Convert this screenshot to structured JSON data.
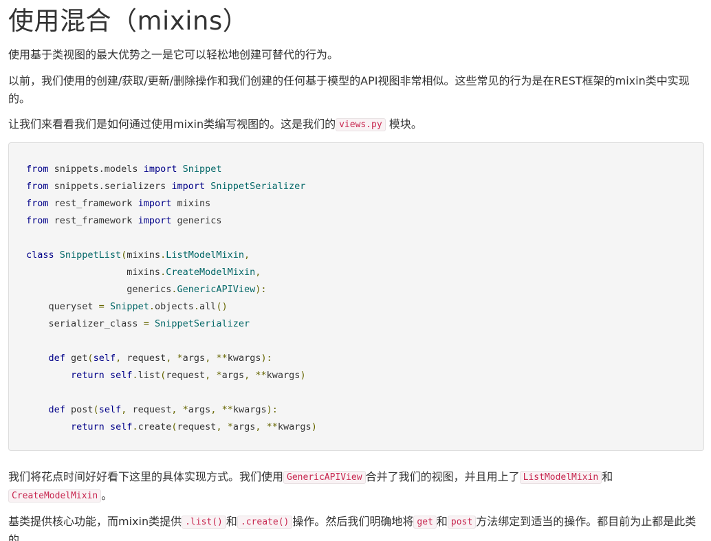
{
  "heading": "使用混合（mixins）",
  "para1": "使用基于类视图的最大优势之一是它可以轻松地创建可替代的行为。",
  "para2": "以前，我们使用的创建/获取/更新/删除操作和我们创建的任何基于模型的API视图非常相似。这些常见的行为是在REST框架的mixin类中实现的。",
  "para3": {
    "before": "让我们来看看我们是如何通过使用mixin类编写视图的。这是我们的",
    "code": "views.py",
    "after": "模块。"
  },
  "code_lines": [
    [
      {
        "t": "from",
        "c": "kw"
      },
      {
        "t": " snippets.models ",
        "c": "pl"
      },
      {
        "t": "import",
        "c": "kw"
      },
      {
        "t": " ",
        "c": "pl"
      },
      {
        "t": "Snippet",
        "c": "tp"
      }
    ],
    [
      {
        "t": "from",
        "c": "kw"
      },
      {
        "t": " snippets.serializers ",
        "c": "pl"
      },
      {
        "t": "import",
        "c": "kw"
      },
      {
        "t": " ",
        "c": "pl"
      },
      {
        "t": "SnippetSerializer",
        "c": "tp"
      }
    ],
    [
      {
        "t": "from",
        "c": "kw"
      },
      {
        "t": " rest_framework ",
        "c": "pl"
      },
      {
        "t": "import",
        "c": "kw"
      },
      {
        "t": " mixins",
        "c": "pl"
      }
    ],
    [
      {
        "t": "from",
        "c": "kw"
      },
      {
        "t": " rest_framework ",
        "c": "pl"
      },
      {
        "t": "import",
        "c": "kw"
      },
      {
        "t": " generics",
        "c": "pl"
      }
    ],
    [],
    [
      {
        "t": "class",
        "c": "kw"
      },
      {
        "t": " ",
        "c": "pl"
      },
      {
        "t": "SnippetList",
        "c": "tp"
      },
      {
        "t": "(",
        "c": "pn"
      },
      {
        "t": "mixins",
        "c": "pl"
      },
      {
        "t": ".",
        "c": "pn"
      },
      {
        "t": "ListModelMixin",
        "c": "tp"
      },
      {
        "t": ",",
        "c": "pn"
      }
    ],
    [
      {
        "t": "                  mixins",
        "c": "pl"
      },
      {
        "t": ".",
        "c": "pn"
      },
      {
        "t": "CreateModelMixin",
        "c": "tp"
      },
      {
        "t": ",",
        "c": "pn"
      }
    ],
    [
      {
        "t": "                  generics",
        "c": "pl"
      },
      {
        "t": ".",
        "c": "pn"
      },
      {
        "t": "GenericAPIView",
        "c": "tp"
      },
      {
        "t": "):",
        "c": "pn"
      }
    ],
    [
      {
        "t": "    queryset ",
        "c": "pl"
      },
      {
        "t": "=",
        "c": "pn"
      },
      {
        "t": " ",
        "c": "pl"
      },
      {
        "t": "Snippet",
        "c": "tp"
      },
      {
        "t": ".",
        "c": "pn"
      },
      {
        "t": "objects",
        "c": "pl"
      },
      {
        "t": ".",
        "c": "pn"
      },
      {
        "t": "all",
        "c": "pl"
      },
      {
        "t": "()",
        "c": "pn"
      }
    ],
    [
      {
        "t": "    serializer_class ",
        "c": "pl"
      },
      {
        "t": "=",
        "c": "pn"
      },
      {
        "t": " ",
        "c": "pl"
      },
      {
        "t": "SnippetSerializer",
        "c": "tp"
      }
    ],
    [],
    [
      {
        "t": "    ",
        "c": "pl"
      },
      {
        "t": "def",
        "c": "kw"
      },
      {
        "t": " get",
        "c": "pl"
      },
      {
        "t": "(",
        "c": "pn"
      },
      {
        "t": "self",
        "c": "kw"
      },
      {
        "t": ",",
        "c": "pn"
      },
      {
        "t": " request",
        "c": "pl"
      },
      {
        "t": ",",
        "c": "pn"
      },
      {
        "t": " ",
        "c": "pl"
      },
      {
        "t": "*",
        "c": "pn"
      },
      {
        "t": "args",
        "c": "pl"
      },
      {
        "t": ",",
        "c": "pn"
      },
      {
        "t": " ",
        "c": "pl"
      },
      {
        "t": "**",
        "c": "pn"
      },
      {
        "t": "kwargs",
        "c": "pl"
      },
      {
        "t": "):",
        "c": "pn"
      }
    ],
    [
      {
        "t": "        ",
        "c": "pl"
      },
      {
        "t": "return",
        "c": "kw"
      },
      {
        "t": " ",
        "c": "pl"
      },
      {
        "t": "self",
        "c": "kw"
      },
      {
        "t": ".",
        "c": "pn"
      },
      {
        "t": "list",
        "c": "pl"
      },
      {
        "t": "(",
        "c": "pn"
      },
      {
        "t": "request",
        "c": "pl"
      },
      {
        "t": ",",
        "c": "pn"
      },
      {
        "t": " ",
        "c": "pl"
      },
      {
        "t": "*",
        "c": "pn"
      },
      {
        "t": "args",
        "c": "pl"
      },
      {
        "t": ",",
        "c": "pn"
      },
      {
        "t": " ",
        "c": "pl"
      },
      {
        "t": "**",
        "c": "pn"
      },
      {
        "t": "kwargs",
        "c": "pl"
      },
      {
        "t": ")",
        "c": "pn"
      }
    ],
    [],
    [
      {
        "t": "    ",
        "c": "pl"
      },
      {
        "t": "def",
        "c": "kw"
      },
      {
        "t": " post",
        "c": "pl"
      },
      {
        "t": "(",
        "c": "pn"
      },
      {
        "t": "self",
        "c": "kw"
      },
      {
        "t": ",",
        "c": "pn"
      },
      {
        "t": " request",
        "c": "pl"
      },
      {
        "t": ",",
        "c": "pn"
      },
      {
        "t": " ",
        "c": "pl"
      },
      {
        "t": "*",
        "c": "pn"
      },
      {
        "t": "args",
        "c": "pl"
      },
      {
        "t": ",",
        "c": "pn"
      },
      {
        "t": " ",
        "c": "pl"
      },
      {
        "t": "**",
        "c": "pn"
      },
      {
        "t": "kwargs",
        "c": "pl"
      },
      {
        "t": "):",
        "c": "pn"
      }
    ],
    [
      {
        "t": "        ",
        "c": "pl"
      },
      {
        "t": "return",
        "c": "kw"
      },
      {
        "t": " ",
        "c": "pl"
      },
      {
        "t": "self",
        "c": "kw"
      },
      {
        "t": ".",
        "c": "pn"
      },
      {
        "t": "create",
        "c": "pl"
      },
      {
        "t": "(",
        "c": "pn"
      },
      {
        "t": "request",
        "c": "pl"
      },
      {
        "t": ",",
        "c": "pn"
      },
      {
        "t": " ",
        "c": "pl"
      },
      {
        "t": "*",
        "c": "pn"
      },
      {
        "t": "args",
        "c": "pl"
      },
      {
        "t": ",",
        "c": "pn"
      },
      {
        "t": " ",
        "c": "pl"
      },
      {
        "t": "**",
        "c": "pn"
      },
      {
        "t": "kwargs",
        "c": "pl"
      },
      {
        "t": ")",
        "c": "pn"
      }
    ]
  ],
  "para4": {
    "t1": "我们将花点时间好好看下这里的具体实现方式。我们使用",
    "c1": "GenericAPIView",
    "t2": "合并了我们的视图，并且用上了",
    "c2": "ListModelMixin",
    "t3": "和",
    "c3": "CreateModelMixin",
    "t4": "。"
  },
  "para5": {
    "t1": "基类提供核心功能，而mixin类提供",
    "c1": ".list()",
    "t2": "和",
    "c2": ".create()",
    "t3": "操作。然后我们明确地将",
    "c3": "get",
    "t4": "和",
    "c4": "post",
    "t5": "方法绑定到适当的操作。都目前为止都是此类的"
  }
}
